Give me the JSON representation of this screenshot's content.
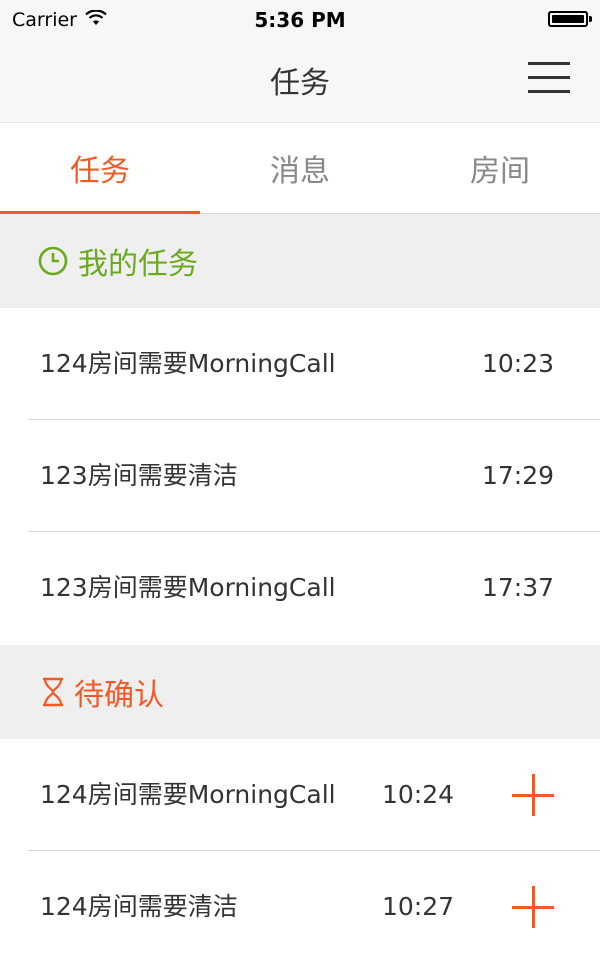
{
  "status_bar": {
    "carrier": "Carrier",
    "time": "5:36 PM"
  },
  "nav": {
    "title": "任务"
  },
  "tabs": [
    {
      "label": "任务",
      "active": true
    },
    {
      "label": "消息",
      "active": false
    },
    {
      "label": "房间",
      "active": false
    }
  ],
  "my_tasks": {
    "header": "我的任务",
    "color": "#6aaa1f",
    "icon": "clock-icon",
    "items": [
      {
        "title": "124房间需要MorningCall",
        "time": "10:23"
      },
      {
        "title": "123房间需要清洁",
        "time": "17:29"
      },
      {
        "title": "123房间需要MorningCall",
        "time": "17:37"
      }
    ]
  },
  "pending": {
    "header": "待确认",
    "color": "#f15a24",
    "icon": "hourglass-icon",
    "items": [
      {
        "title": "124房间需要MorningCall",
        "time": "10:24"
      },
      {
        "title": "124房间需要清洁",
        "time": "10:27"
      }
    ]
  },
  "colors": {
    "accent": "#f15a24",
    "green": "#6aaa1f"
  }
}
